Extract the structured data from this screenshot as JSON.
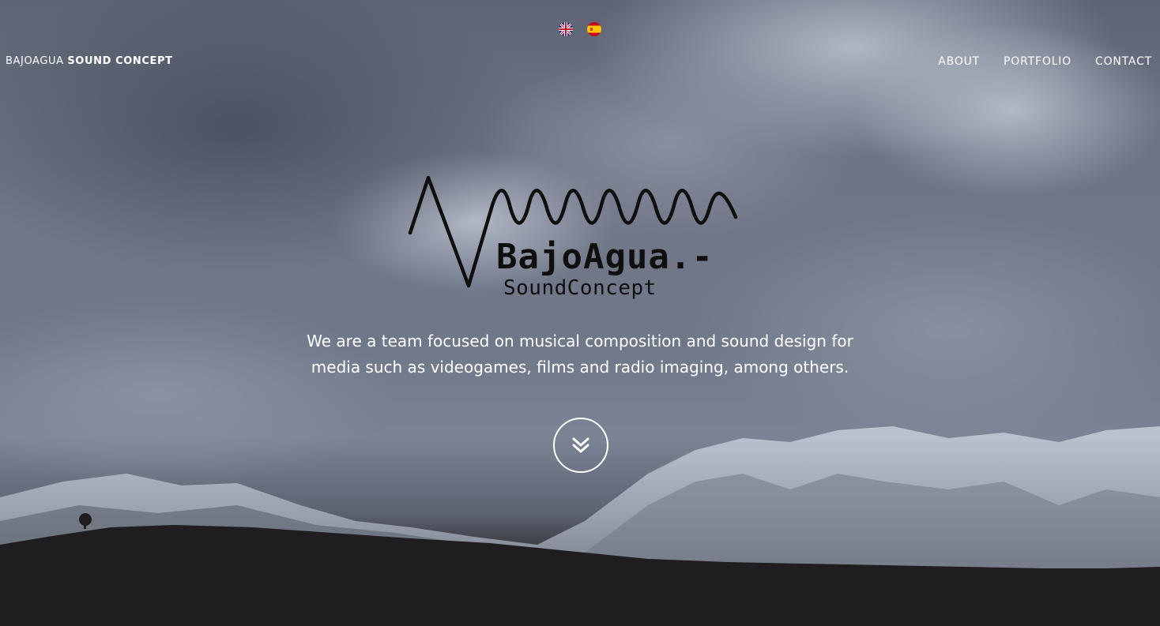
{
  "brand": {
    "light": "BAJOAGUA",
    "bold": "SOUND CONCEPT"
  },
  "languages": [
    {
      "name": "uk-flag-icon"
    },
    {
      "name": "spain-flag-icon"
    }
  ],
  "nav": {
    "items": [
      "ABOUT",
      "PORTFOLIO",
      "CONTACT"
    ]
  },
  "logo": {
    "main": "BajoAgua.-",
    "sub": "SoundConcept"
  },
  "tagline": {
    "line1": "We are a team focused on musical composition and sound design for",
    "line2": "media such as videogames, films and radio imaging, among others."
  },
  "scroll_icon": "double-chevron-down-icon",
  "colors": {
    "text": "#ffffff",
    "logo": "#0f0f10"
  }
}
